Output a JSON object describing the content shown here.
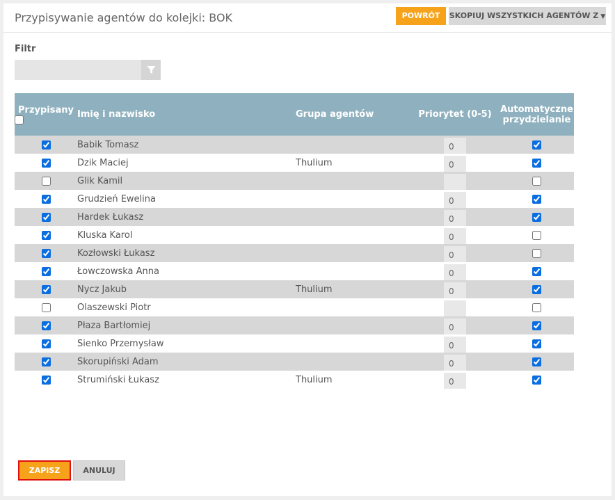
{
  "header": {
    "title": "Przypisywanie agentów do kolejki: BOK",
    "back_label": "POWRÓT",
    "copy_label": "SKOPIUJ WSZYSTKICH AGENTÓW Z"
  },
  "filter": {
    "label": "Filtr",
    "value": "",
    "icon": "filter-icon"
  },
  "table": {
    "columns": {
      "assigned": "Przypisany",
      "name": "Imię i nazwisko",
      "group": "Grupa agentów",
      "priority": "Priorytet (0-5)",
      "auto": "Automatyczne przydzielanie"
    },
    "header_check_all": false,
    "rows": [
      {
        "assigned": true,
        "name": "Babik Tomasz",
        "group": "",
        "priority": "0",
        "auto": true
      },
      {
        "assigned": true,
        "name": "Dzik Maciej",
        "group": "Thulium",
        "priority": "0",
        "auto": true
      },
      {
        "assigned": false,
        "name": "Glik Kamil",
        "group": "",
        "priority": "",
        "auto": false
      },
      {
        "assigned": true,
        "name": "Grudzień Ewelina",
        "group": "",
        "priority": "0",
        "auto": true
      },
      {
        "assigned": true,
        "name": "Hardek Łukasz",
        "group": "",
        "priority": "0",
        "auto": true
      },
      {
        "assigned": true,
        "name": "Kluska Karol",
        "group": "",
        "priority": "0",
        "auto": false
      },
      {
        "assigned": true,
        "name": "Kozłowski Łukasz",
        "group": "",
        "priority": "0",
        "auto": false
      },
      {
        "assigned": true,
        "name": "Łowczowska Anna",
        "group": "",
        "priority": "0",
        "auto": true
      },
      {
        "assigned": true,
        "name": "Nycz Jakub",
        "group": "Thulium",
        "priority": "0",
        "auto": true
      },
      {
        "assigned": false,
        "name": "Olaszewski Piotr",
        "group": "",
        "priority": "",
        "auto": false
      },
      {
        "assigned": true,
        "name": "Płaza Bartłomiej",
        "group": "",
        "priority": "0",
        "auto": true
      },
      {
        "assigned": true,
        "name": "Sienko Przemysław",
        "group": "",
        "priority": "0",
        "auto": true
      },
      {
        "assigned": true,
        "name": "Skorupiński Adam",
        "group": "",
        "priority": "0",
        "auto": true
      },
      {
        "assigned": true,
        "name": "Strumiński Łukasz",
        "group": "Thulium",
        "priority": "0",
        "auto": true
      }
    ]
  },
  "footer": {
    "save_label": "ZAPISZ",
    "cancel_label": "ANULUJ"
  },
  "colors": {
    "accent": "#f7a21b",
    "table_header": "#8fb1bf",
    "row_alt": "#d7d7d7",
    "save_border": "#e01010"
  }
}
